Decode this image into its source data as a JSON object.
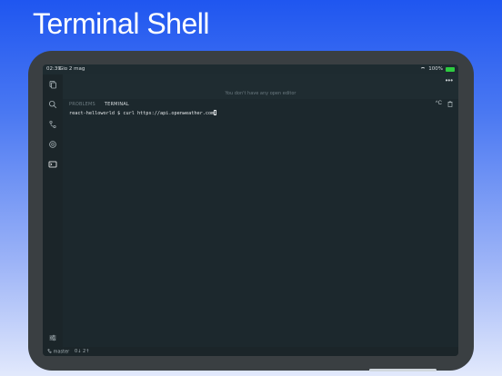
{
  "headline": "Terminal Shell",
  "status": {
    "time": "02:39",
    "date": "Gio 2 mag",
    "battery": "100%"
  },
  "editor": {
    "empty_message": "You don't have any open editor",
    "more": "•••"
  },
  "panel": {
    "tabs": [
      {
        "label": "PROBLEMS"
      },
      {
        "label": "TERMINAL"
      }
    ],
    "actions": {
      "interrupt": "^C",
      "trash": "🗑"
    }
  },
  "terminal": {
    "prompt": "react-helloworld $ ",
    "command": "curl https://api.openweather.com"
  },
  "statusbar": {
    "branch": "master",
    "sync": "0↓ 2↑"
  },
  "icons": {
    "explorer": "files-icon",
    "search": "search-icon",
    "source_control": "git-branch-icon",
    "extensions": "extensions-icon",
    "terminal": "terminal-icon",
    "settings": "settings-icon"
  },
  "colors": {
    "accent_blue": "#1f56f0",
    "battery_green": "#2ecc40"
  }
}
